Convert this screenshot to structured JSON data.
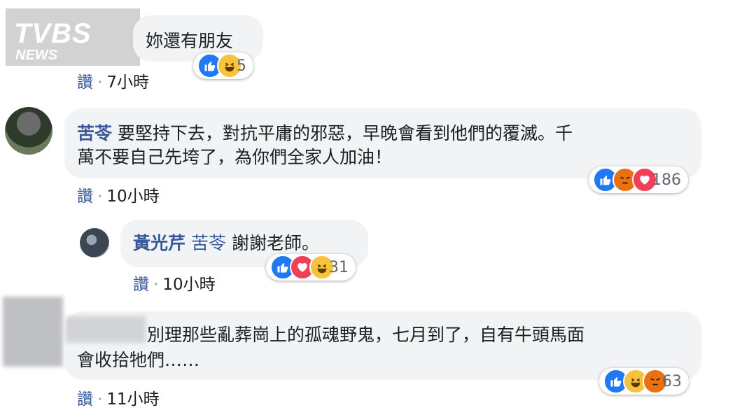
{
  "logo": {
    "text": "TVBS",
    "sub": "NEWS"
  },
  "comments": [
    {
      "text": "妳還有朋友",
      "meta_like": "讚",
      "time": "7小時",
      "reaction_count": "5",
      "icons": [
        "like-icon",
        "haha-icon"
      ]
    },
    {
      "name": "苦苓",
      "line1": "要堅持下去，對抗平庸的邪惡，早晚會看到他們的覆滅。千",
      "line2": "萬不要自己先垮了，為你們全家人加油！",
      "meta_like": "讚",
      "time": "10小時",
      "reaction_count": "186",
      "icons": [
        "like-icon",
        "angry-icon",
        "love-icon"
      ]
    },
    {
      "name": "黃光芹",
      "tag": "苦苓",
      "text": "謝謝老師。",
      "meta_like": "讚",
      "time": "10小時",
      "reaction_count": "31",
      "icons": [
        "like-icon",
        "love-icon",
        "haha-icon"
      ]
    },
    {
      "line1": "別理那些亂葬崗上的孤魂野鬼，七月到了，自有牛頭馬面",
      "line2": "會收拾牠們……",
      "meta_like": "讚",
      "time": "11小時",
      "reaction_count": "63",
      "icons": [
        "like-icon",
        "haha-icon",
        "angry-icon"
      ]
    }
  ],
  "colors": {
    "like": "#2078f4",
    "haha": "#f7c33c",
    "angry": "#e9710f",
    "love": "#f33e58",
    "link": "#385898"
  }
}
